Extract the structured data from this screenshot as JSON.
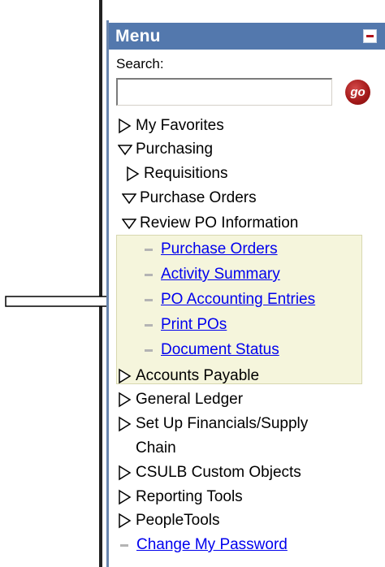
{
  "menu": {
    "title": "Menu",
    "search_label": "Search:",
    "search_value": "",
    "go_label": "go",
    "items": {
      "my_favorites": "My Favorites",
      "purchasing": "Purchasing",
      "requisitions": "Requisitions",
      "purchase_orders": "Purchase Orders",
      "review_po_information": "Review PO Information",
      "links": {
        "purchase_orders": "Purchase Orders",
        "activity_summary": "Activity Summary",
        "po_accounting_entries": "PO Accounting Entries",
        "print_pos": "Print POs",
        "document_status": "Document Status"
      },
      "accounts_payable": "Accounts Payable",
      "general_ledger": "General Ledger",
      "set_up_line1": "Set Up Financials/Supply",
      "set_up_line2": "Chain",
      "csulb_custom_objects": "CSULB Custom Objects",
      "reporting_tools": "Reporting Tools",
      "peopletools": "PeopleTools",
      "change_my_password": "Change My Password"
    }
  },
  "colors": {
    "header_bg": "#5378ad",
    "highlight_bg": "#f5f5dc",
    "link": "#0000ee",
    "go_button": "#a21818"
  },
  "icons": {
    "collapse": "minus-icon",
    "closed_folder": "triangle-right-icon",
    "open_folder": "triangle-down-icon",
    "leaf": "dash-icon",
    "pointer": "arrow-right-icon"
  }
}
